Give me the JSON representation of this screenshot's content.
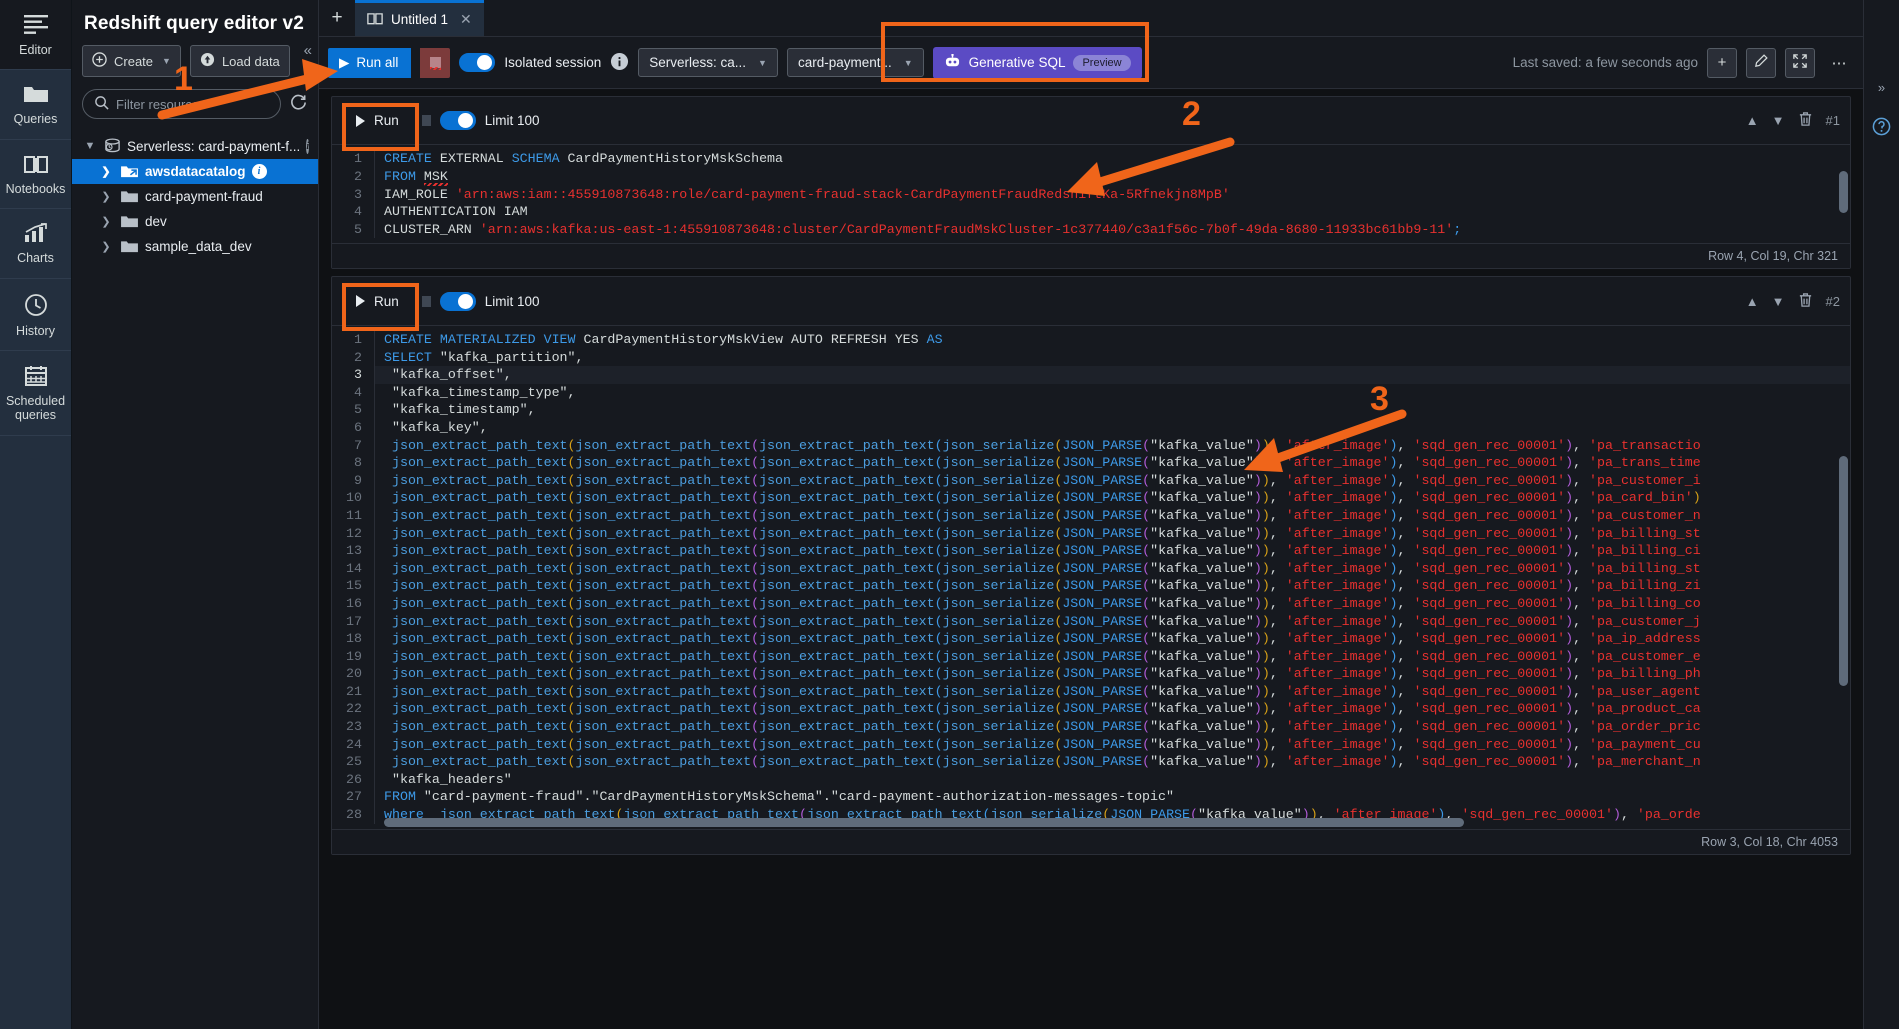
{
  "rail": {
    "items": [
      {
        "label": "Editor",
        "icon": "editor-icon",
        "active": true
      },
      {
        "label": "Queries",
        "icon": "folder-icon",
        "active": false
      },
      {
        "label": "Notebooks",
        "icon": "notebook-icon",
        "active": false
      },
      {
        "label": "Charts",
        "icon": "chart-icon",
        "active": false
      },
      {
        "label": "History",
        "icon": "clock-icon",
        "active": false
      },
      {
        "label": "Scheduled queries",
        "icon": "calendar-icon",
        "active": false
      }
    ]
  },
  "resources": {
    "title": "Redshift query editor v2",
    "create_label": "Create",
    "load_data_label": "Load data",
    "collapse_icon": "collapse-panel-icon",
    "search_placeholder": "Filter resources",
    "search_value": "",
    "refresh_icon": "refresh-icon",
    "tree": [
      {
        "label": "Serverless: card-payment-f...",
        "level": 0,
        "expanded": true,
        "icon": "cluster-icon",
        "selected": false,
        "info": false,
        "kebab": true
      },
      {
        "label": "awsdatacatalog",
        "level": 1,
        "expanded": false,
        "icon": "datacatalog-icon",
        "selected": true,
        "info": true,
        "kebab": false
      },
      {
        "label": "card-payment-fraud",
        "level": 1,
        "expanded": false,
        "icon": "database-icon",
        "selected": false,
        "info": false,
        "kebab": false
      },
      {
        "label": "dev",
        "level": 1,
        "expanded": false,
        "icon": "database-icon",
        "selected": false,
        "info": false,
        "kebab": false
      },
      {
        "label": "sample_data_dev",
        "level": 1,
        "expanded": false,
        "icon": "database-icon",
        "selected": false,
        "info": false,
        "kebab": false
      }
    ]
  },
  "tabs": {
    "new_tab_icon": "plus-icon",
    "items": [
      {
        "label": "Untitled 1",
        "icon": "notebook-icon",
        "close_icon": "close-icon",
        "active": true
      }
    ]
  },
  "toolbar": {
    "run_all_label": "Run all",
    "stop_icon": "stop-icon",
    "isolated_session_label": "Isolated session",
    "isolated_session_on": true,
    "info_icon": "info-icon",
    "connection_select": "Serverless: ca...",
    "database_select": "card-payment...",
    "generative_sql_label": "Generative SQL",
    "generative_sql_badge": "Preview",
    "generative_sql_icon": "robot-icon",
    "last_saved": "Last saved: a few seconds ago",
    "add_icon": "plus-icon",
    "edit_icon": "pencil-icon",
    "expand_icon": "fullscreen-icon",
    "more_icon": "ellipsis-icon"
  },
  "annotations": [
    {
      "number": "1"
    },
    {
      "number": "2"
    },
    {
      "number": "3"
    }
  ],
  "cells": [
    {
      "run_label": "Run",
      "limit_label": "Limit 100",
      "limit_on": true,
      "cell_id": "#1",
      "collapse_up_icon": "chevron-up-icon",
      "collapse_down_icon": "chevron-down-icon",
      "delete_icon": "trash-icon",
      "status": "Row 4,   Col 19,   Chr 321",
      "lines": [
        {
          "n": "1",
          "frag": [
            [
              "k",
              "CREATE"
            ],
            [
              "w",
              " EXTERNAL "
            ],
            [
              "k",
              "SCHEMA"
            ],
            [
              "w",
              " CardPaymentHistoryMskSchema"
            ]
          ]
        },
        {
          "n": "2",
          "frag": [
            [
              "k",
              "FROM"
            ],
            [
              "w",
              " "
            ],
            [
              "sq",
              "MSK"
            ]
          ]
        },
        {
          "n": "3",
          "frag": [
            [
              "w",
              "IAM_ROLE "
            ],
            [
              "s",
              "'arn:aws:iam::455910873648:role/card-payment-fraud-stack-CardPaymentFraudRedshiftKa-5Rfnekjn8MpB'"
            ]
          ]
        },
        {
          "n": "4",
          "frag": [
            [
              "w",
              "AUTHENTICATION IAM"
            ]
          ]
        },
        {
          "n": "5",
          "frag": [
            [
              "w",
              "CLUSTER_ARN "
            ],
            [
              "s",
              "'arn:aws:kafka:us-east-1:455910873648:cluster/CardPaymentFraudMskCluster-1c377440/c3a1f56c-7b0f-49da-8680-11933bc61bb9-11'"
            ],
            [
              "p3",
              ";"
            ]
          ]
        }
      ]
    },
    {
      "run_label": "Run",
      "limit_label": "Limit 100",
      "limit_on": true,
      "cell_id": "#2",
      "collapse_up_icon": "chevron-up-icon",
      "collapse_down_icon": "chevron-down-icon",
      "delete_icon": "trash-icon",
      "status": "Row 3,   Col 18,   Chr 4053",
      "current_line": 3,
      "lines": [
        {
          "n": "1",
          "frag": [
            [
              "k",
              "CREATE MATERIALIZED VIEW"
            ],
            [
              "w",
              " CardPaymentHistoryMskView AUTO REFRESH YES "
            ],
            [
              "k",
              "AS"
            ]
          ]
        },
        {
          "n": "2",
          "frag": [
            [
              "k",
              "SELECT"
            ],
            [
              "w",
              " \"kafka_partition\","
            ]
          ]
        },
        {
          "n": "3",
          "frag": [
            [
              "w",
              " \"kafka_offset\","
            ]
          ]
        },
        {
          "n": "4",
          "frag": [
            [
              "w",
              " \"kafka_timestamp_type\","
            ]
          ]
        },
        {
          "n": "5",
          "frag": [
            [
              "w",
              " \"kafka_timestamp\","
            ]
          ]
        },
        {
          "n": "6",
          "frag": [
            [
              "w",
              " \"kafka_key\","
            ]
          ]
        },
        {
          "n": "7",
          "tail": "'pa_transactio"
        },
        {
          "n": "8",
          "tail": "'pa_trans_time"
        },
        {
          "n": "9",
          "tail": "'pa_customer_i"
        },
        {
          "n": "10",
          "tail": "'pa_card_bin')"
        },
        {
          "n": "11",
          "tail": "'pa_customer_n"
        },
        {
          "n": "12",
          "tail": "'pa_billing_st"
        },
        {
          "n": "13",
          "tail": "'pa_billing_ci"
        },
        {
          "n": "14",
          "tail": "'pa_billing_st"
        },
        {
          "n": "15",
          "tail": "'pa_billing_zi"
        },
        {
          "n": "16",
          "tail": "'pa_billing_co"
        },
        {
          "n": "17",
          "tail": "'pa_customer_j"
        },
        {
          "n": "18",
          "tail": "'pa_ip_address"
        },
        {
          "n": "19",
          "tail": "'pa_customer_e"
        },
        {
          "n": "20",
          "tail": "'pa_billing_ph"
        },
        {
          "n": "21",
          "tail": "'pa_user_agent"
        },
        {
          "n": "22",
          "tail": "'pa_product_ca"
        },
        {
          "n": "23",
          "tail": "'pa_order_pric"
        },
        {
          "n": "24",
          "tail": "'pa_payment_cu"
        },
        {
          "n": "25",
          "tail": "'pa_merchant_n"
        },
        {
          "n": "26",
          "frag": [
            [
              "w",
              " \"kafka_headers\""
            ]
          ]
        },
        {
          "n": "27",
          "frag": [
            [
              "k",
              "FROM"
            ],
            [
              "w",
              " \"card-payment-fraud\".\"CardPaymentHistoryMskSchema\".\"card-payment-authorization-messages-topic\""
            ]
          ]
        },
        {
          "n": "28",
          "frag": [
            [
              "k",
              "where"
            ],
            [
              "w",
              "  "
            ],
            [
              "fn",
              "json_extract_path_text"
            ],
            [
              "p1",
              "("
            ],
            [
              "fn",
              "json_extract_path_text"
            ],
            [
              "p2",
              "("
            ],
            [
              "fn",
              "json_extract_path_text"
            ],
            [
              "p3",
              "("
            ],
            [
              "fn",
              "json_serialize"
            ],
            [
              "p1",
              "("
            ],
            [
              "k",
              "JSON_PARSE"
            ],
            [
              "p2",
              "("
            ],
            [
              "w",
              "\"kafka_value\""
            ],
            [
              "p2",
              ")"
            ],
            [
              "p1",
              ")"
            ],
            [
              "w",
              ", "
            ],
            [
              "s",
              "'after_image'"
            ],
            [
              "p3",
              ")"
            ],
            [
              "w",
              ", "
            ],
            [
              "s",
              "'sqd_gen_rec_00001'"
            ],
            [
              "p2",
              ")"
            ],
            [
              "w",
              ", "
            ],
            [
              "s",
              "'pa_orde"
            ]
          ]
        }
      ],
      "repeated_expr": {
        "f1": "json_extract_path_text",
        "f2": "json_extract_path_text",
        "f3": "json_extract_path_text",
        "f4": "json_serialize",
        "f5": "JSON_PARSE",
        "arg": "\"kafka_value\"",
        "p1": "'after_image'",
        "p2": "'sqd_gen_rec_00001'"
      }
    }
  ],
  "right_rail": {
    "items": [
      {
        "icon": "collapse-right-icon"
      },
      {
        "icon": "help-circle-icon"
      }
    ]
  },
  "colors": {
    "accent": "#0972d3",
    "annotation": "#f0651a",
    "generative": "#5b4bc4",
    "string": "#e8312f",
    "keyword": "#3d9ae8"
  }
}
